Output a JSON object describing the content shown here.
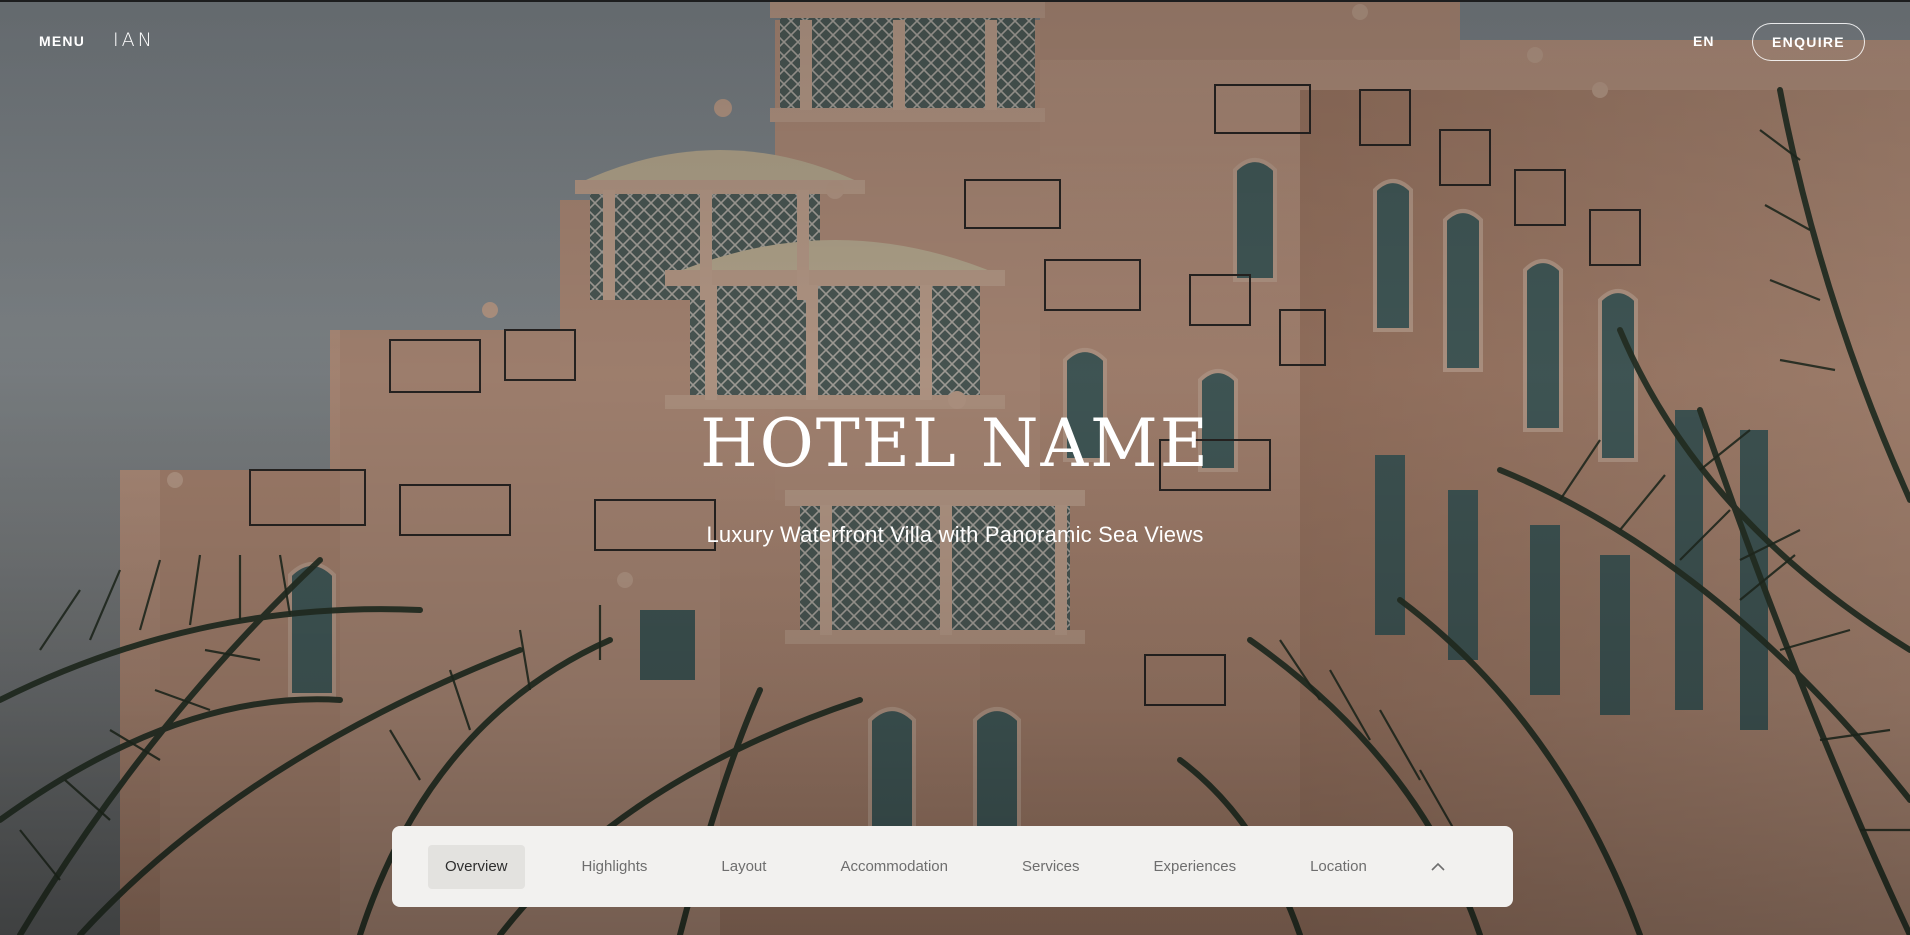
{
  "header": {
    "menu_label": "MENU",
    "logo_text": "IAN",
    "language": "EN",
    "enquire_label": "ENQUIRE"
  },
  "hero": {
    "title": "HOTEL NAME",
    "subtitle": "Luxury Waterfront Villa with Panoramic Sea Views",
    "background_description_icon": "hotel-facade-photo"
  },
  "section_nav": {
    "items": [
      {
        "label": "Overview",
        "active": true
      },
      {
        "label": "Highlights",
        "active": false
      },
      {
        "label": "Layout",
        "active": false
      },
      {
        "label": "Accommodation",
        "active": false
      },
      {
        "label": "Services",
        "active": false
      },
      {
        "label": "Experiences",
        "active": false
      },
      {
        "label": "Location",
        "active": false
      }
    ],
    "toggle_icon": "chevron-up-icon"
  },
  "colors": {
    "nav_background": "#f2f1ef",
    "nav_active_background": "#e3e2df",
    "nav_text": "#6e6e6e",
    "facade": "#c79e87",
    "palm": "#2f3a2c"
  }
}
